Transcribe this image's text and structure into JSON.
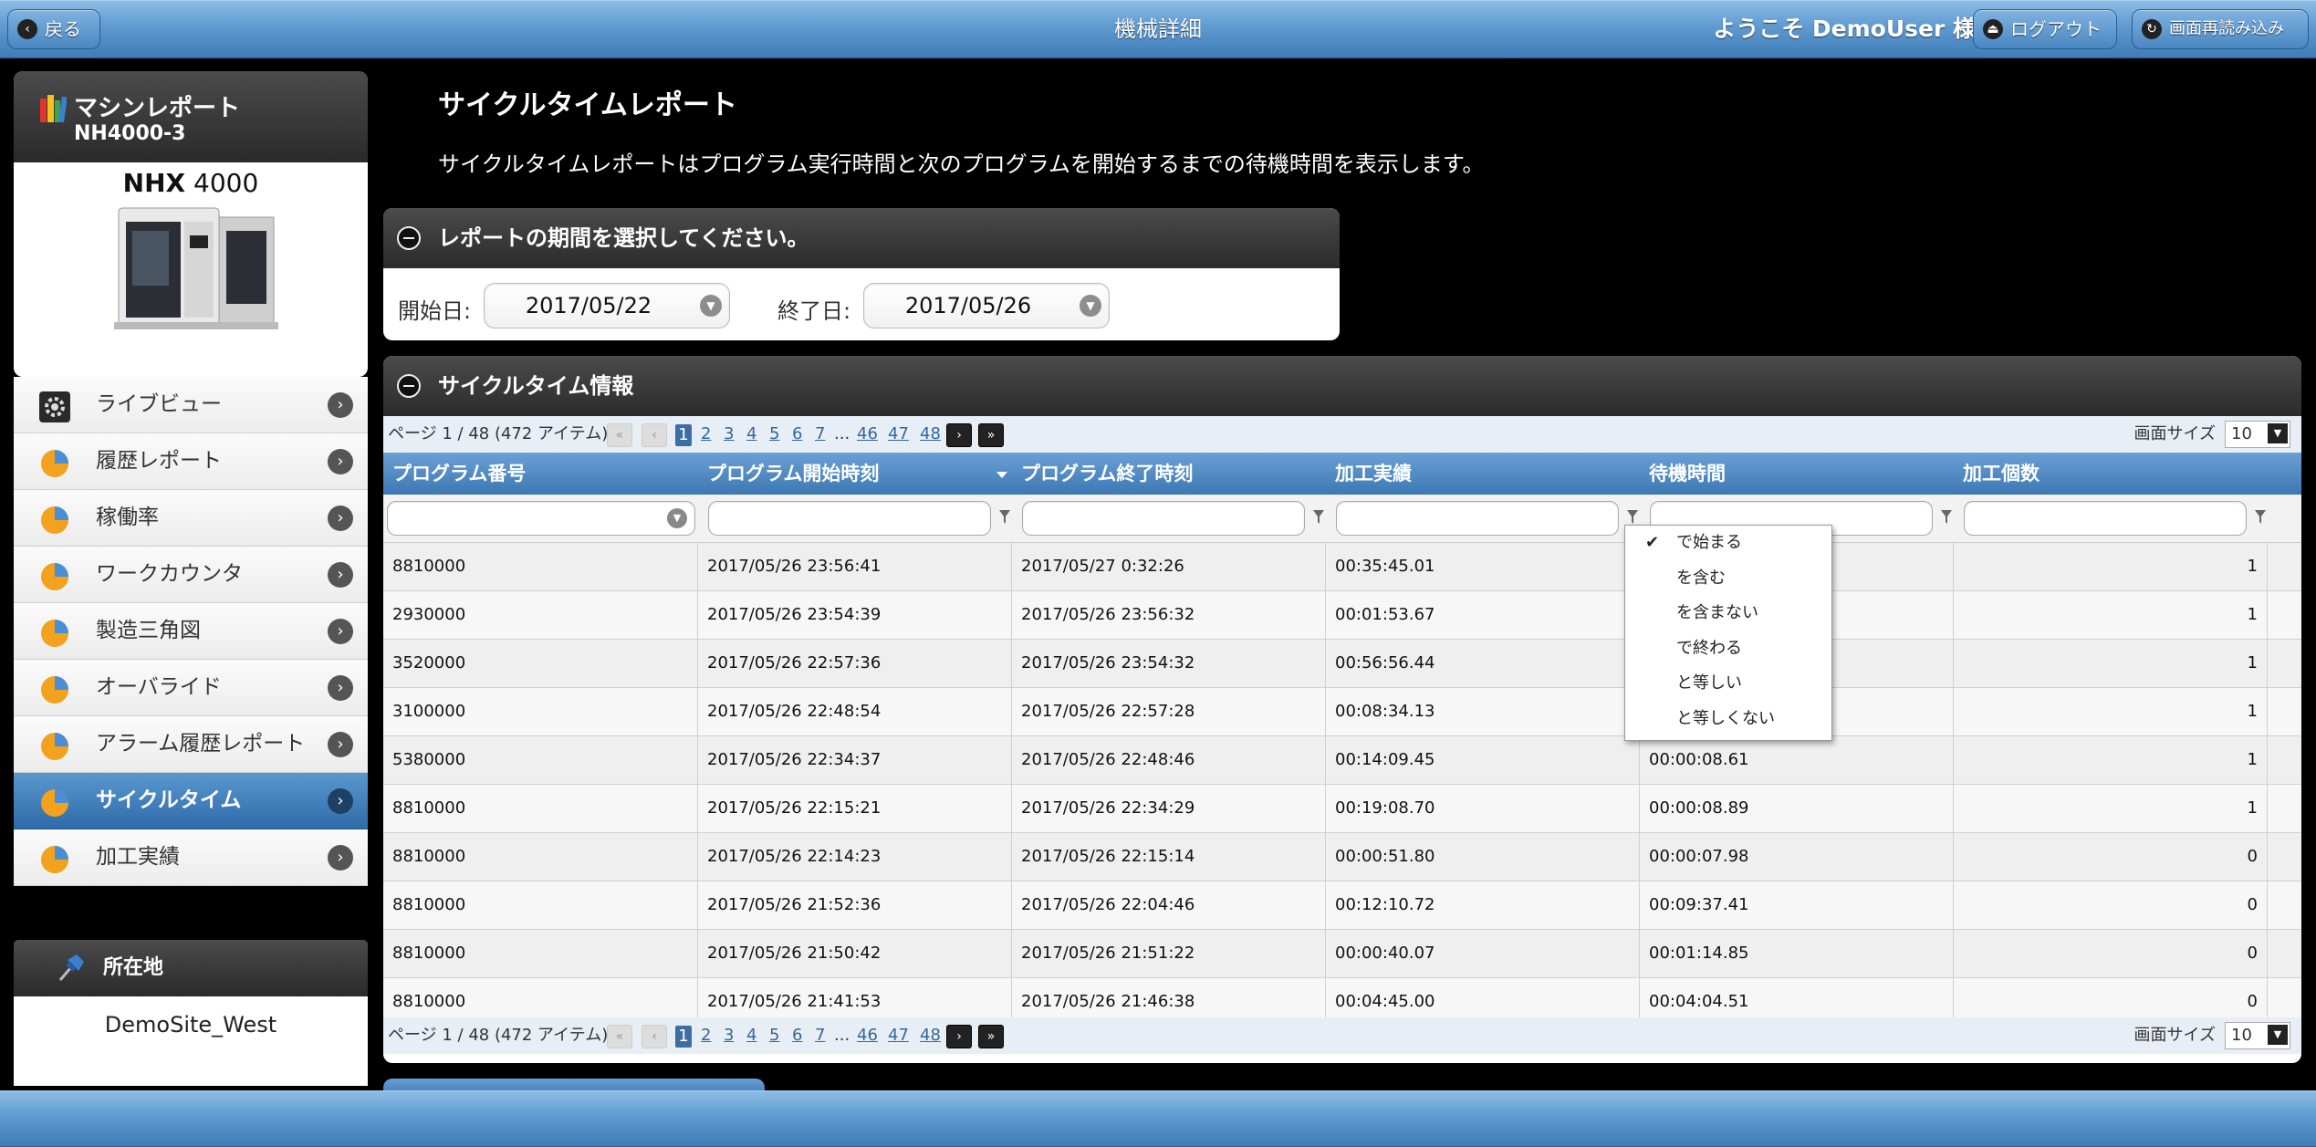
{
  "header": {
    "back_label": "戻る",
    "title": "機械詳細",
    "welcome": "ようこそ DemoUser 様",
    "logout_label": "ログアウト",
    "reload_label": "画面再読み込み"
  },
  "sidebar": {
    "card_title": "マシンレポート",
    "machine_id": "NH4000-3",
    "model_bold": "NHX",
    "model_num": " 4000",
    "items": [
      {
        "label": "ライブビュー",
        "icon": "gear-icon"
      },
      {
        "label": "履歴レポート",
        "icon": "pie-chart-icon"
      },
      {
        "label": "稼働率",
        "icon": "pie-chart-icon"
      },
      {
        "label": "ワークカウンタ",
        "icon": "pie-chart-icon"
      },
      {
        "label": "製造三角図",
        "icon": "pie-chart-icon"
      },
      {
        "label": "オーバライド",
        "icon": "pie-chart-icon"
      },
      {
        "label": "アラーム履歴レポート",
        "icon": "pie-chart-icon"
      },
      {
        "label": "サイクルタイム",
        "icon": "pie-chart-icon",
        "active": true
      },
      {
        "label": "加工実績",
        "icon": "pie-chart-icon"
      }
    ],
    "location_title": "所在地",
    "location_value": "DemoSite_West"
  },
  "main": {
    "title": "サイクルタイムレポート",
    "description": "サイクルタイムレポートはプログラム実行時間と次のプログラムを開始するまでの待機時間を表示します。",
    "period": {
      "header": "レポートの期間を選択してください。",
      "start_label": "開始日:",
      "start_value": "2017/05/22",
      "end_label": "終了日:",
      "end_value": "2017/05/26"
    },
    "cycle": {
      "header": "サイクルタイム情報",
      "pager": {
        "info": "ページ 1 / 48 (472 アイテム)",
        "first": "«",
        "prev": "‹",
        "pages": [
          "1",
          "2",
          "3",
          "4",
          "5",
          "6",
          "7"
        ],
        "ellipsis": "...",
        "tail_pages": [
          "46",
          "47",
          "48"
        ],
        "next": "›",
        "last": "»",
        "size_label": "画面サイズ",
        "size_value": "10"
      },
      "columns": [
        "プログラム番号",
        "プログラム開始時刻",
        "プログラム終了時刻",
        "加工実績",
        "待機時間",
        "加工個数"
      ],
      "rows": [
        [
          "8810000",
          "2017/05/26 23:56:41",
          "2017/05/27 0:32:26",
          "00:35:45.01",
          "",
          "1"
        ],
        [
          "2930000",
          "2017/05/26 23:54:39",
          "2017/05/26 23:56:32",
          "00:01:53.67",
          "",
          "1"
        ],
        [
          "3520000",
          "2017/05/26 22:57:36",
          "2017/05/26 23:54:32",
          "00:56:56.44",
          "",
          "1"
        ],
        [
          "3100000",
          "2017/05/26 22:48:54",
          "2017/05/26 22:57:28",
          "00:08:34.13",
          "",
          "1"
        ],
        [
          "5380000",
          "2017/05/26 22:34:37",
          "2017/05/26 22:48:46",
          "00:14:09.45",
          "00:00:08.61",
          "1"
        ],
        [
          "8810000",
          "2017/05/26 22:15:21",
          "2017/05/26 22:34:29",
          "00:19:08.70",
          "00:00:08.89",
          "1"
        ],
        [
          "8810000",
          "2017/05/26 22:14:23",
          "2017/05/26 22:15:14",
          "00:00:51.80",
          "00:00:07.98",
          "0"
        ],
        [
          "8810000",
          "2017/05/26 21:52:36",
          "2017/05/26 22:04:46",
          "00:12:10.72",
          "00:09:37.41",
          "0"
        ],
        [
          "8810000",
          "2017/05/26 21:50:42",
          "2017/05/26 21:51:22",
          "00:00:40.07",
          "00:01:14.85",
          "0"
        ],
        [
          "8810000",
          "2017/05/26 21:41:53",
          "2017/05/26 21:46:38",
          "00:04:45.00",
          "00:04:04.51",
          "0"
        ]
      ],
      "filter_menu": [
        {
          "label": "で始まる",
          "checked": true
        },
        {
          "label": "を含む"
        },
        {
          "label": "を含まない"
        },
        {
          "label": "で終わる"
        },
        {
          "label": "と等しい"
        },
        {
          "label": "と等しくない"
        }
      ]
    }
  },
  "colors": {
    "accent_blue": "#3d78b4",
    "panel_dark": "#2b2b2b",
    "background": "#000000"
  }
}
